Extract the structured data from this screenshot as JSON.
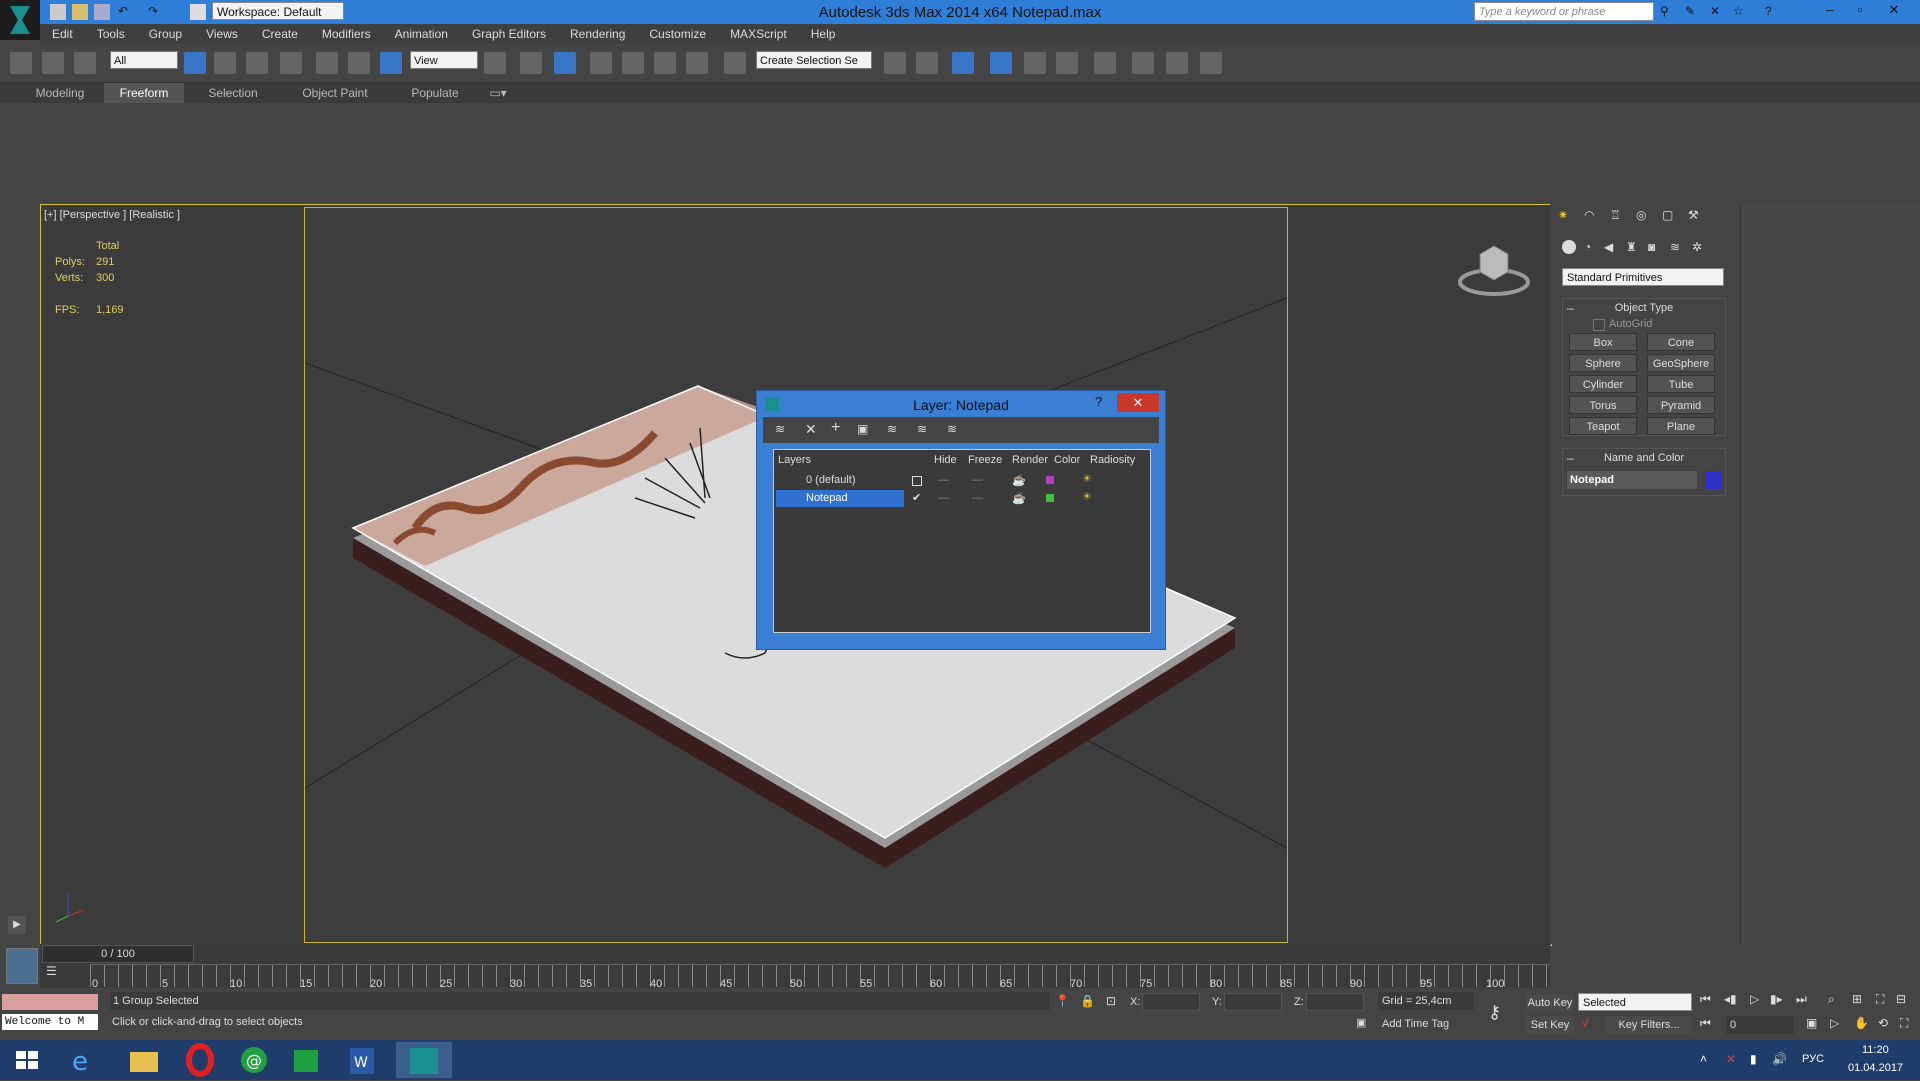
{
  "app": {
    "title": "Autodesk 3ds Max  2014 x64     Notepad.max",
    "workspace": "Workspace: Default",
    "search_placeholder": "Type a keyword or phrase"
  },
  "menu": [
    "Edit",
    "Tools",
    "Group",
    "Views",
    "Create",
    "Modifiers",
    "Animation",
    "Graph Editors",
    "Rendering",
    "Customize",
    "MAXScript",
    "Help"
  ],
  "toolbar": {
    "filter": "All",
    "refcoord": "View",
    "selection_set": "Create Selection Se"
  },
  "ribbon_tabs": [
    "Modeling",
    "Freeform",
    "Selection",
    "Object Paint",
    "Populate"
  ],
  "viewport": {
    "label": "[+] [Perspective ] [Realistic ]",
    "stats": {
      "total_label": "Total",
      "polys_label": "Polys:",
      "polys": "291",
      "verts_label": "Verts:",
      "verts": "300",
      "fps_label": "FPS:",
      "fps": "1,169"
    }
  },
  "layer_dialog": {
    "title": "Layer: Notepad",
    "help": "?",
    "close": "✕",
    "headers": [
      "Layers",
      "Hide",
      "Freeze",
      "Render",
      "Color",
      "Radiosity"
    ],
    "rows": [
      {
        "name": "0 (default)",
        "color": "#b040c0"
      },
      {
        "name": "Notepad",
        "color": "#40c040"
      }
    ]
  },
  "command_panel": {
    "dropdown": "Standard Primitives",
    "object_type_title": "Object Type",
    "autogrid": "AutoGrid",
    "buttons": [
      "Box",
      "Cone",
      "Sphere",
      "GeoSphere",
      "Cylinder",
      "Tube",
      "Torus",
      "Pyramid",
      "Teapot",
      "Plane"
    ],
    "name_color_title": "Name and Color",
    "name": "Notepad",
    "color": "#3030c8"
  },
  "timeline": {
    "frame": "0 / 100",
    "ticks": [
      "0",
      "5",
      "10",
      "15",
      "20",
      "25",
      "30",
      "35",
      "40",
      "45",
      "50",
      "55",
      "60",
      "65",
      "70",
      "75",
      "80",
      "85",
      "90",
      "95",
      "100"
    ]
  },
  "status": {
    "welcome": "Welcome to M",
    "selected": "1 Group Selected",
    "prompt": "Click or click-and-drag to select objects",
    "x_label": "X:",
    "y_label": "Y:",
    "z_label": "Z:",
    "grid": "Grid = 25,4cm",
    "add_time_tag": "Add Time Tag",
    "auto_key": "Auto Key",
    "set_key": "Set Key",
    "selected_dropdown": "Selected",
    "key_filters": "Key Filters...",
    "frame_value": "0"
  },
  "taskbar": {
    "lang": "РУС",
    "time": "11:20",
    "date": "01.04.2017"
  }
}
